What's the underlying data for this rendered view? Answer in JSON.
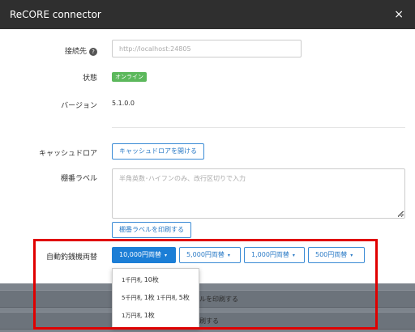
{
  "window": {
    "title": "ReCORE connector",
    "close_label": "×"
  },
  "connection": {
    "label": "接続先",
    "help_icon": "?",
    "placeholder": "http://localhost:24805"
  },
  "status": {
    "label": "状態",
    "value": "オンライン",
    "color": "#5cb85c"
  },
  "version": {
    "label": "バージョン",
    "value": "5.1.0.0"
  },
  "cash_drawer": {
    "label": "キャッシュドロア",
    "button": "キャッシュドロアを開ける"
  },
  "shelf_label": {
    "label": "棚番ラベル",
    "placeholder": "半角英数･ハイフンのみ、改行区切りで入力",
    "print_button": "棚番ラベルを印刷する"
  },
  "changer": {
    "label": "自動釣銭機両替",
    "buttons": [
      {
        "label": "10,000円両替",
        "selected": true
      },
      {
        "label": "5,000円両替",
        "selected": false
      },
      {
        "label": "1,000円両替",
        "selected": false
      },
      {
        "label": "500円両替",
        "selected": false
      }
    ],
    "caret": "▾",
    "dropdown_items": [
      {
        "prefix": "1千円札",
        "count": "10枚"
      },
      {
        "prefix": "5千円札",
        "count": "1枚",
        "prefix2": "1千円札",
        "count2": "5枚"
      },
      {
        "prefix": "1万円札",
        "count": "1枚"
      }
    ]
  },
  "background_bars": [
    {
      "text": "ルを印刷する"
    },
    {
      "text": "刷する"
    }
  ],
  "colors": {
    "accent": "#1c7ed6",
    "highlight": "#e00000",
    "header_bg": "#2f2f2f"
  }
}
